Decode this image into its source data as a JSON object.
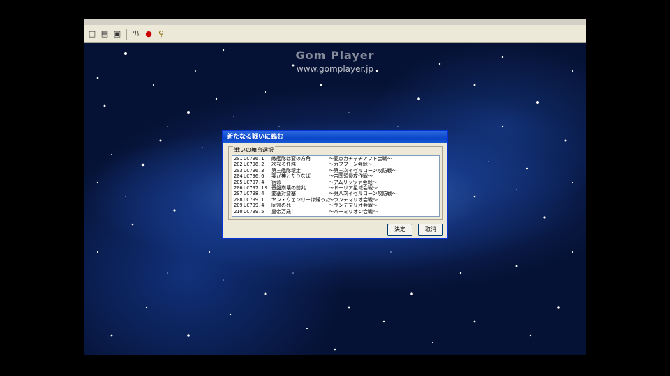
{
  "window": {
    "watermark_logo": "Gom Player",
    "watermark_url": "www.gomplayer.jp"
  },
  "toolbar": {
    "icons": [
      "new-icon",
      "open-icon",
      "save-icon",
      "edit-icon",
      "record-icon",
      "pin-icon"
    ],
    "glyphs": [
      "□",
      "▤",
      "▣",
      "ℬ",
      "●",
      "♀"
    ]
  },
  "dialog": {
    "title": "新たなる戦いに臨む",
    "group_label": "戦いの舞台選択",
    "rows": [
      {
        "no": "201",
        "date": "UC796.1",
        "title": "敵艦隊は要の方角",
        "subtitle": "～要点カチャチアフト会戦～"
      },
      {
        "no": "202",
        "date": "UC796.2",
        "title": "次なる任務",
        "subtitle": "～カフフーン会戦～"
      },
      {
        "no": "203",
        "date": "UC796.3",
        "title": "第三艦隊壊走",
        "subtitle": "～第三次イゼルローン攻防戦～"
      },
      {
        "no": "204",
        "date": "UC796.6",
        "title": "我が神とたりなば",
        "subtitle": "～帝国領侵攻作戦～"
      },
      {
        "no": "205",
        "date": "UC797.4",
        "title": "宿命",
        "subtitle": "～アムリッツァ会戦～"
      },
      {
        "no": "206",
        "date": "UC797.10",
        "title": "基盤崩壊の前兆",
        "subtitle": "～ドーリア星域会戦～"
      },
      {
        "no": "207",
        "date": "UC798.4",
        "title": "要塞対要塞",
        "subtitle": "～第八次イゼルローン攻防戦～"
      },
      {
        "no": "208",
        "date": "UC799.1",
        "title": "ヤン・ウェンリーは帰った",
        "subtitle": "～ランテマリオ会戦～"
      },
      {
        "no": "209",
        "date": "UC799.4",
        "title": "同盟の死",
        "subtitle": "～ランテマリオ会戦～"
      },
      {
        "no": "210",
        "date": "UC799.5",
        "title": "皇帝万歳！",
        "subtitle": "～バーミリオン会戦～"
      }
    ],
    "ok_label": "決定",
    "cancel_label": "取消"
  }
}
